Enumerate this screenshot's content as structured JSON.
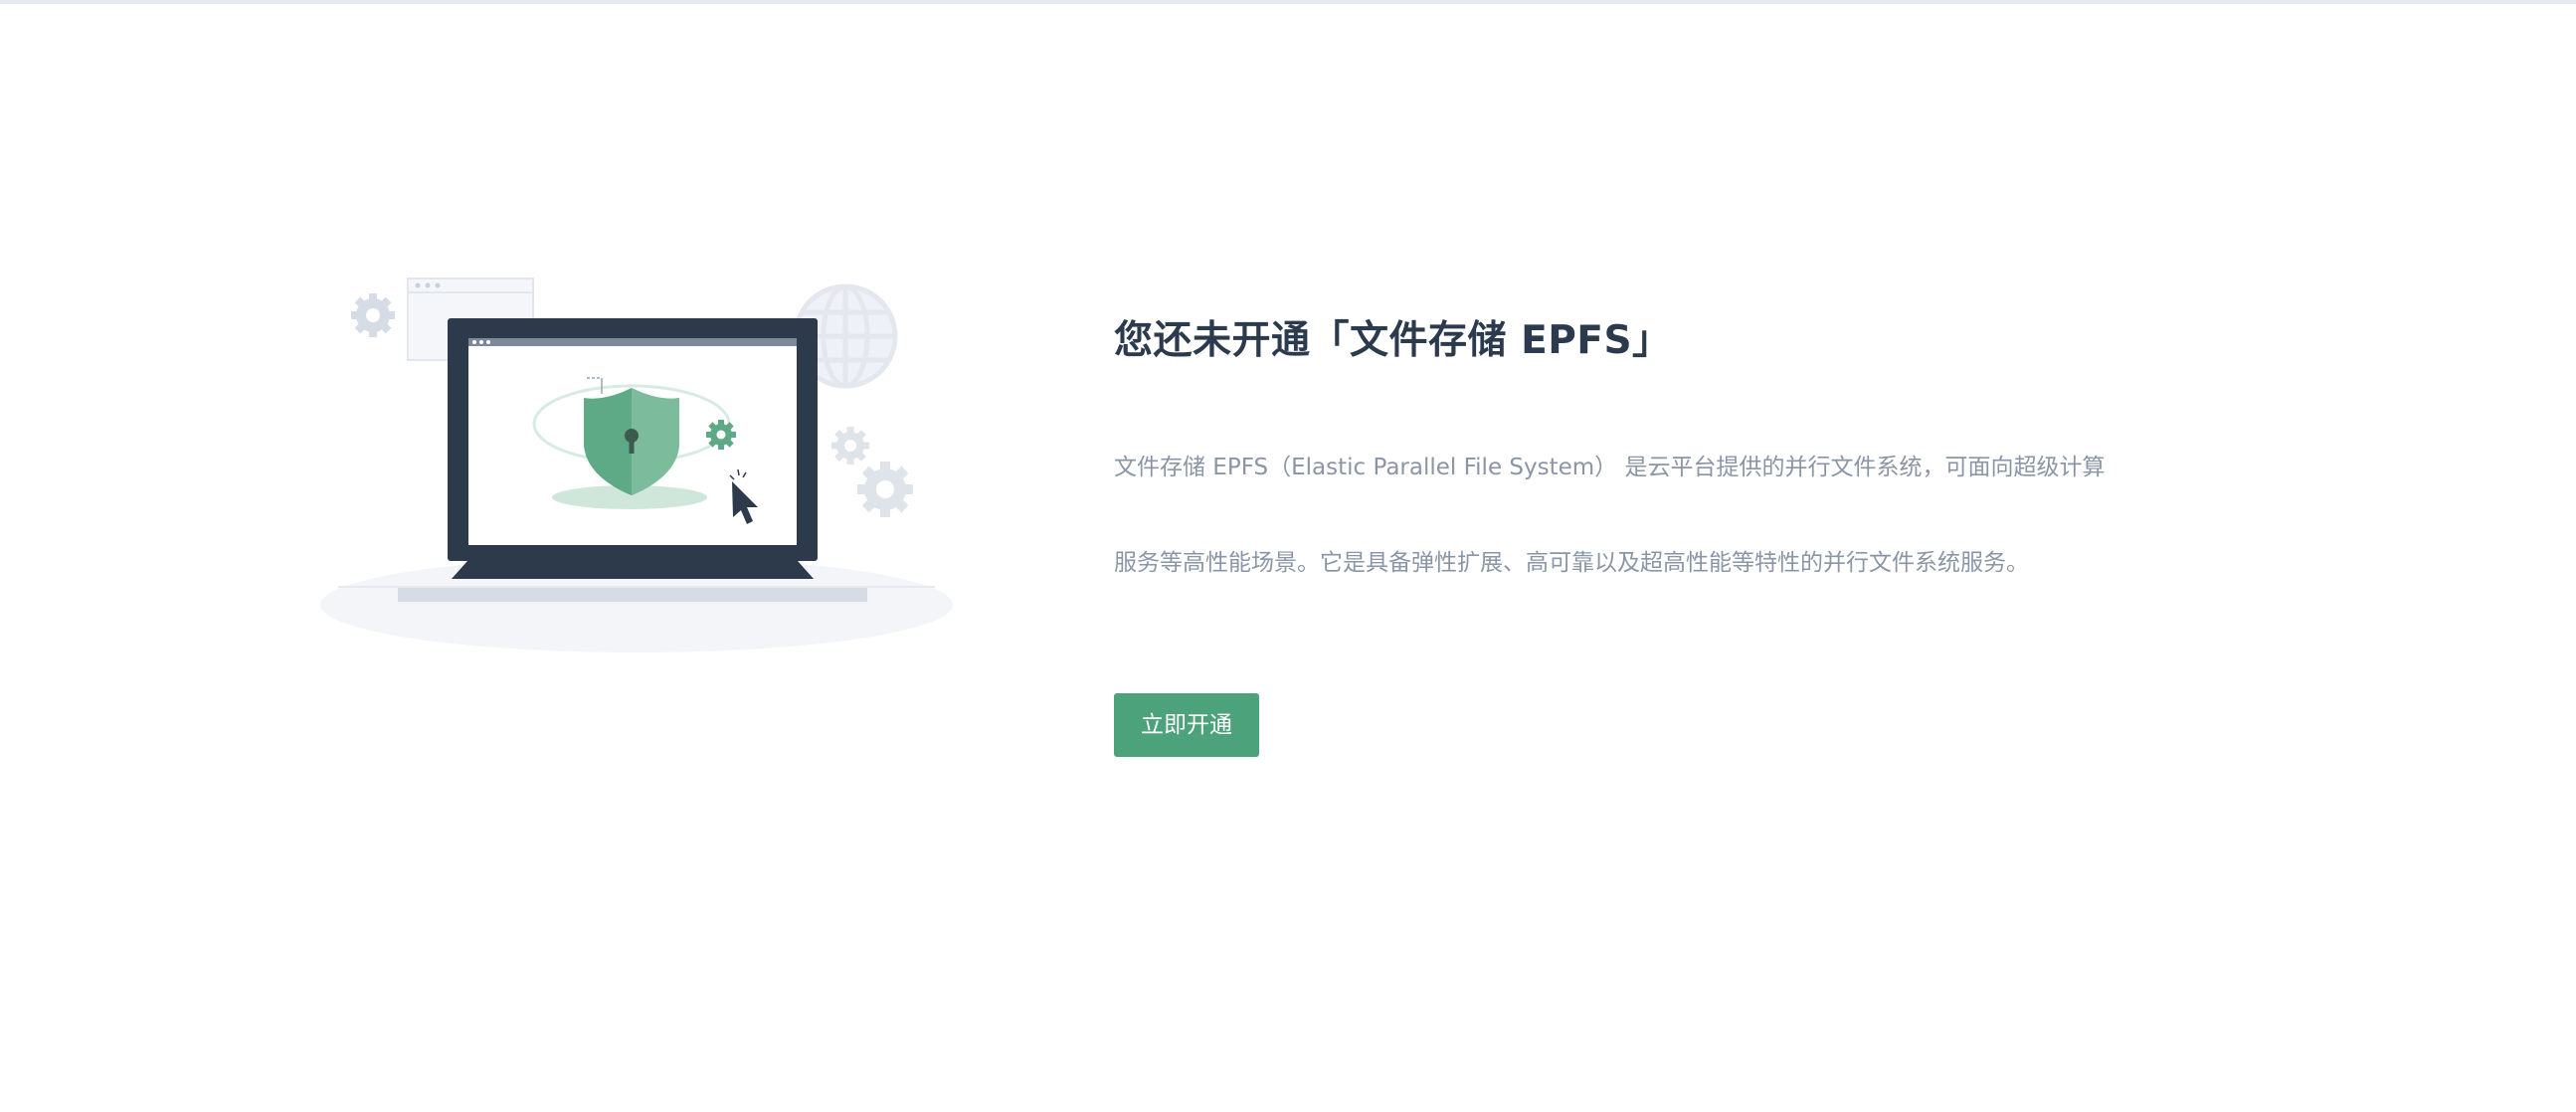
{
  "empty_state": {
    "title": "您还未开通「文件存储 EPFS」",
    "description_line1": "文件存储 EPFS（Elastic Parallel File System） 是云平台提供的并行文件系统，可面向超级计算",
    "description_line2": "服务等高性能场景。它是具备弹性扩展、高可靠以及超高性能等特性的并行文件系统服务。",
    "button_label": "立即开通",
    "illustration": "laptop-with-security-shield"
  },
  "colors": {
    "accent": "#4ba27b",
    "title": "#2c3a4e",
    "description": "#8a95a6"
  }
}
